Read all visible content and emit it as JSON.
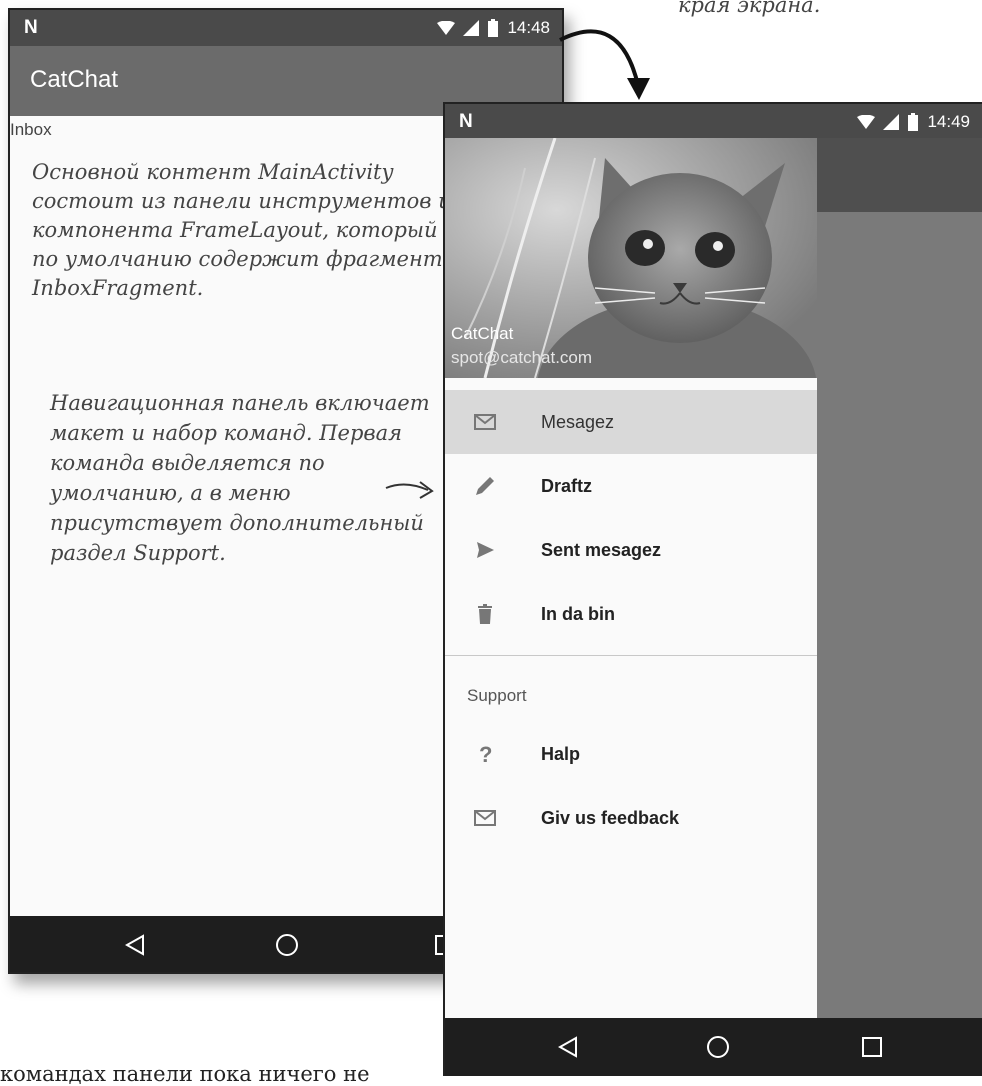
{
  "annotation_top": "края экрана.",
  "left_phone": {
    "status_time": "14:48",
    "app_title": "CatChat",
    "inbox_label": "Inbox",
    "annotation_main": "Основной контент MainActivity состоит из панели инструментов и компонента FrameLayout, который по умолчанию содержит фрагмент InboxFragment.",
    "annotation_nav": "Навигационная панель включает макет и набор команд. Первая команда выделяется по умолчанию, а в меню присутствует дополнительный раздел Support."
  },
  "right_phone": {
    "status_time": "14:49",
    "header": {
      "name": "CatChat",
      "email": "spot@catchat.com"
    },
    "menu": [
      {
        "label": "Mesagez",
        "icon": "envelope-icon",
        "selected": true
      },
      {
        "label": "Draftz",
        "icon": "pencil-icon"
      },
      {
        "label": "Sent mesagez",
        "icon": "send-icon"
      },
      {
        "label": "In da bin",
        "icon": "trash-icon"
      }
    ],
    "support_header": "Support",
    "support_menu": [
      {
        "label": "Halp",
        "icon": "help-icon"
      },
      {
        "label": "Giv us feedback",
        "icon": "envelope-icon"
      }
    ]
  },
  "bottom_text": "командах панели пока ничего не",
  "colors": {
    "appbar": "#6b6b6b",
    "statusbar": "#4a4a4a",
    "selected_item": "#d9d9d9",
    "navbar": "#1e1e1e"
  }
}
